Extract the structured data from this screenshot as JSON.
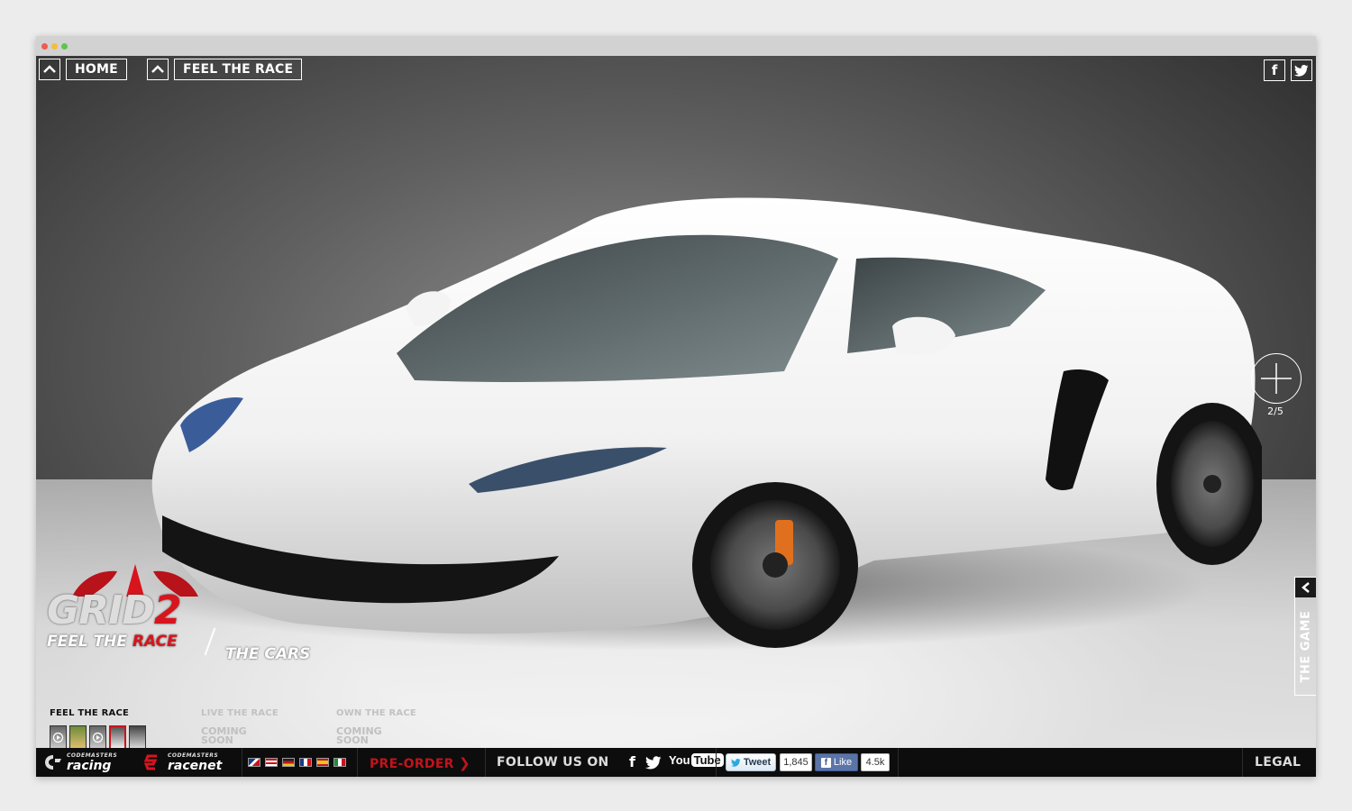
{
  "colors": {
    "brand_red": "#c8141c",
    "footer_bg": "#0d0d0d",
    "stage_dark": "#2d2d2d"
  },
  "nav": {
    "home_label": "HOME",
    "feel_label": "FEEL THE RACE",
    "up_icon": "chevron-up-icon"
  },
  "social_top": {
    "facebook_glyph": "f",
    "twitter_icon": "twitter-icon"
  },
  "zoom": {
    "counter": "2/5",
    "icon": "plus-icon"
  },
  "side_tab": {
    "label": "THE GAME",
    "icon": "chevron-left-icon"
  },
  "logo": {
    "grid": "GRID",
    "two": "2",
    "feel": "FEEL THE",
    "race": "RACE",
    "the_cars": "THE CARS"
  },
  "sections": {
    "feel": {
      "title": "FEEL THE RACE"
    },
    "live": {
      "title": "LIVE THE RACE",
      "status": "COMING SOON"
    },
    "own": {
      "title": "OWN THE RACE",
      "status": "COMING SOON"
    }
  },
  "footer": {
    "brand1_small": "CODEMASTERS",
    "brand1": "racing",
    "brand2_small": "CODEMASTERS",
    "brand2": "racenet",
    "preorder": "PRE-ORDER",
    "follow": "FOLLOW US ON",
    "facebook_glyph": "f",
    "youtube_you": "You",
    "youtube_tube": "Tube",
    "tweet": "Tweet",
    "tweet_count": "1,845",
    "like": "Like",
    "like_count": "4.5k",
    "legal": "LEGAL"
  }
}
